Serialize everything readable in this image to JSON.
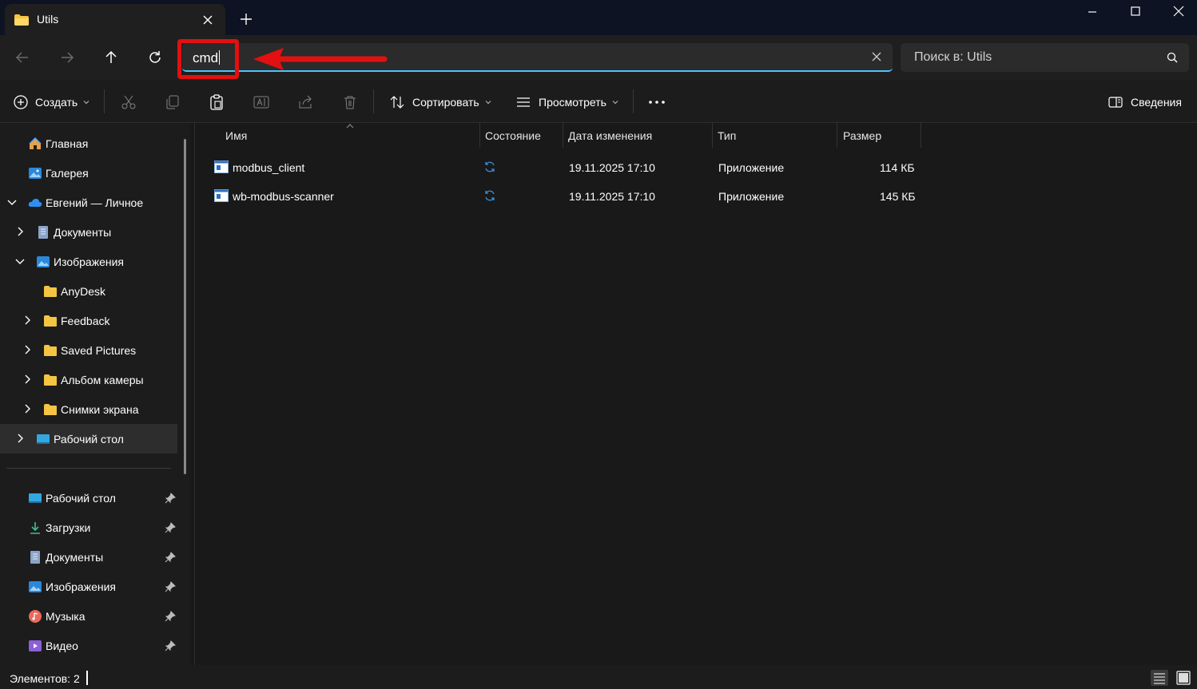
{
  "window": {
    "tab_title": "Utils",
    "controls": [
      "minimize",
      "maximize",
      "close"
    ]
  },
  "address": {
    "value": "cmd",
    "search_placeholder": "Поиск в: Utils"
  },
  "annotation": {
    "highlight_color": "#e21010"
  },
  "toolbar": {
    "create_label": "Создать",
    "sort_label": "Сортировать",
    "view_label": "Просмотреть",
    "details_label": "Сведения"
  },
  "sidebar": {
    "items": [
      {
        "label": "Главная",
        "icon": "home-icon"
      },
      {
        "label": "Галерея",
        "icon": "gallery-icon"
      },
      {
        "label": "Евгений — Личное",
        "icon": "onedrive-icon"
      },
      {
        "label": "Документы",
        "icon": "documents-icon"
      },
      {
        "label": "Изображения",
        "icon": "pictures-icon"
      },
      {
        "label": "AnyDesk",
        "icon": "folder-icon"
      },
      {
        "label": "Feedback",
        "icon": "folder-icon"
      },
      {
        "label": "Saved Pictures",
        "icon": "folder-icon"
      },
      {
        "label": "Альбом камеры",
        "icon": "folder-icon"
      },
      {
        "label": "Снимки экрана",
        "icon": "folder-icon"
      },
      {
        "label": "Рабочий стол",
        "icon": "desktop-icon"
      }
    ],
    "pinned": [
      {
        "label": "Рабочий стол",
        "icon": "desktop-icon"
      },
      {
        "label": "Загрузки",
        "icon": "downloads-icon"
      },
      {
        "label": "Документы",
        "icon": "documents-icon"
      },
      {
        "label": "Изображения",
        "icon": "pictures-icon"
      },
      {
        "label": "Музыка",
        "icon": "music-icon"
      },
      {
        "label": "Видео",
        "icon": "video-icon"
      }
    ]
  },
  "list": {
    "columns": [
      "Имя",
      "Состояние",
      "Дата изменения",
      "Тип",
      "Размер"
    ],
    "rows": [
      {
        "name": "modbus_client",
        "status": "sync-icon",
        "date": "19.11.2025 17:10",
        "type": "Приложение",
        "size": "114 КБ"
      },
      {
        "name": "wb-modbus-scanner",
        "status": "sync-icon",
        "date": "19.11.2025 17:10",
        "type": "Приложение",
        "size": "145 КБ"
      }
    ]
  },
  "status": {
    "items_count": "Элементов: 2"
  }
}
